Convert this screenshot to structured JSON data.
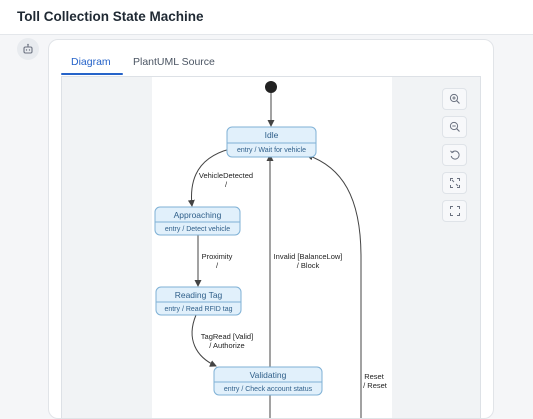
{
  "header": {
    "title": "Toll Collection State Machine"
  },
  "sidebar": {
    "assistant_icon": "robot-icon"
  },
  "tabs": [
    {
      "label": "Diagram",
      "active": true
    },
    {
      "label": "PlantUML Source",
      "active": false
    }
  ],
  "colors": {
    "accent": "#2563c9",
    "state_fill": "#e1f0fb",
    "state_border": "#7fb1d6",
    "state_title": "#2f5f8a",
    "arrow": "#444444"
  },
  "diagram": {
    "states": [
      {
        "name": "Idle",
        "entry": "entry / Wait for vehicle"
      },
      {
        "name": "Approaching",
        "entry": "entry / Detect vehicle"
      },
      {
        "name": "Reading Tag",
        "entry": "entry / Read RFID tag"
      },
      {
        "name": "Validating",
        "entry": "entry / Check account status"
      }
    ],
    "transitions": [
      {
        "from": "Idle",
        "to": "Approaching",
        "lines": [
          "VehicleDetected",
          "/"
        ]
      },
      {
        "from": "Approaching",
        "to": "Reading Tag",
        "lines": [
          "Proximity",
          "/"
        ]
      },
      {
        "from": "Reading Tag",
        "to": "Validating",
        "lines": [
          "TagRead [Valid]",
          "/ Authorize"
        ]
      },
      {
        "from": "Validating",
        "to": "Idle",
        "lines": [
          "Invalid [BalanceLow]",
          "/ Block"
        ]
      },
      {
        "from": "…",
        "to": "Idle",
        "lines": [
          "Reset",
          "/ Reset"
        ]
      }
    ]
  },
  "zoom_controls": [
    {
      "name": "zoom-in-icon",
      "action": "zoom in"
    },
    {
      "name": "zoom-out-icon",
      "action": "zoom out"
    },
    {
      "name": "reset-icon",
      "action": "reset"
    },
    {
      "name": "fit-icon",
      "action": "fit"
    },
    {
      "name": "fullscreen-icon",
      "action": "fullscreen"
    }
  ]
}
